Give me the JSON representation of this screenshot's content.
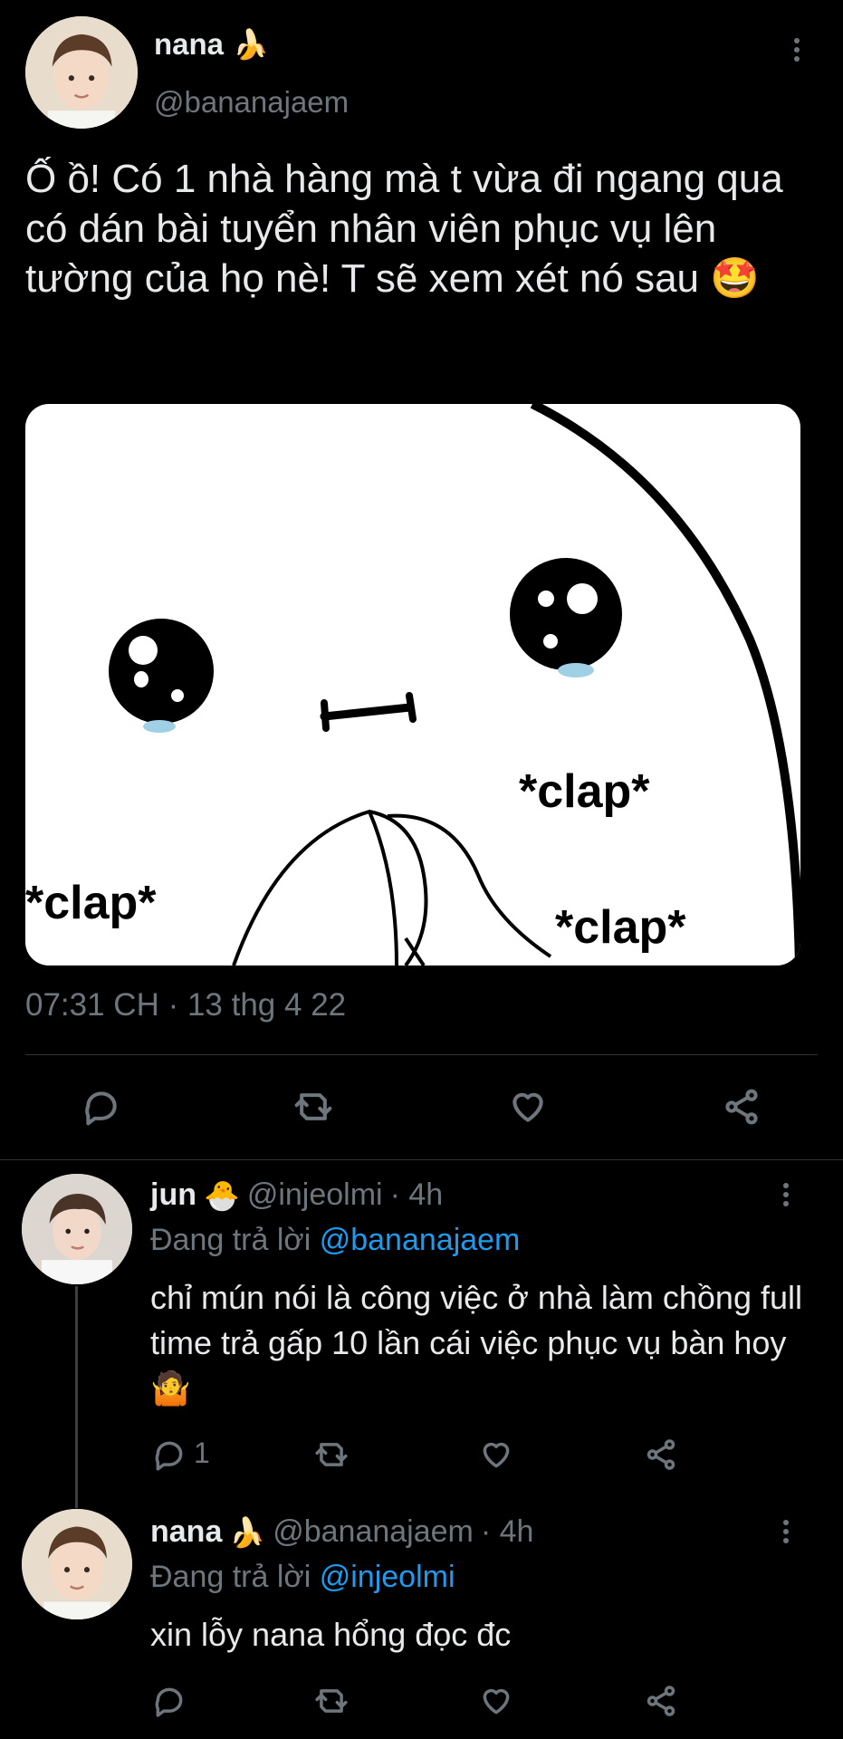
{
  "main_tweet": {
    "display_name": "nana",
    "name_emoji": "🍌",
    "handle": "@bananajaem",
    "text": "Ố ồ! Có 1 nhà hàng mà t vừa đi ngang qua có dán bài tuyển nhân viên phục vụ lên tường của họ nè! T sẽ xem xét nó sau 🤩",
    "image_texts": [
      "*clap*",
      "*clap*",
      "*clap*"
    ],
    "timestamp": "07:31 CH · 13 thg 4 22",
    "actions": [
      "reply-icon",
      "retweet-icon",
      "like-icon",
      "share-icon"
    ]
  },
  "replies": [
    {
      "display_name": "jun",
      "name_emoji": "🐣",
      "handle": "@injeolmi",
      "time": "· 4h",
      "replying_label": "Đang trả lời",
      "replying_to": "@bananajaem",
      "text": "chỉ mún nói là công việc ở nhà làm chồng full time trả gấp 10 lần cái việc phục vụ bàn hoy 🤷",
      "reply_count": "1"
    },
    {
      "display_name": "nana",
      "name_emoji": "🍌",
      "handle": "@bananajaem",
      "time": "· 4h",
      "replying_label": "Đang trả lời",
      "replying_to": "@injeolmi",
      "text": "xin lỗy nana hổng đọc đc",
      "reply_count": ""
    }
  ],
  "colors": {
    "background": "#000000",
    "text": "#e7e9ea",
    "muted": "#6e767d",
    "link": "#1d9bf0",
    "divider": "#2f3336"
  }
}
